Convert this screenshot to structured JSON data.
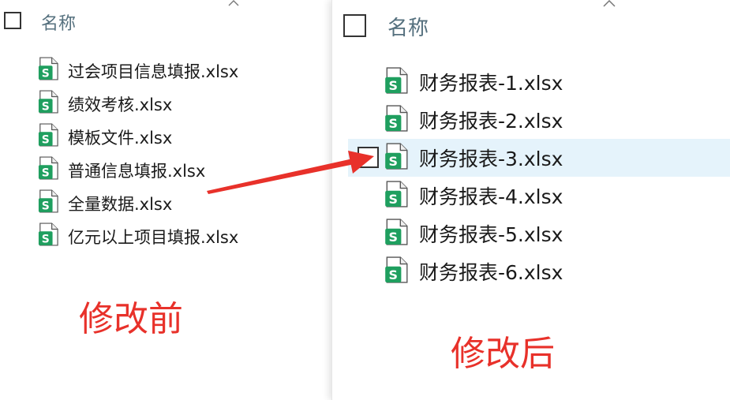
{
  "left": {
    "header": "名称",
    "files": [
      "过会项目信息填报.xlsx",
      "绩效考核.xlsx",
      "模板文件.xlsx",
      "普通信息填报.xlsx",
      "全量数据.xlsx",
      "亿元以上项目填报.xlsx"
    ],
    "note": "修改前"
  },
  "right": {
    "header": "名称",
    "files": [
      "财务报表-1.xlsx",
      "财务报表-2.xlsx",
      "财务报表-3.xlsx",
      "财务报表-4.xlsx",
      "财务报表-5.xlsx",
      "财务报表-6.xlsx"
    ],
    "selected_index": 2,
    "note": "修改后"
  },
  "icons": {
    "file": "xlsx-spreadsheet-icon",
    "collapse": "chevron-up-icon",
    "arrow": "red-arrow"
  },
  "colors": {
    "accent_red": "#e8312a",
    "sheet_green": "#1f9f5f",
    "header_text": "#55707e",
    "hover_row": "#e5f3fb"
  }
}
